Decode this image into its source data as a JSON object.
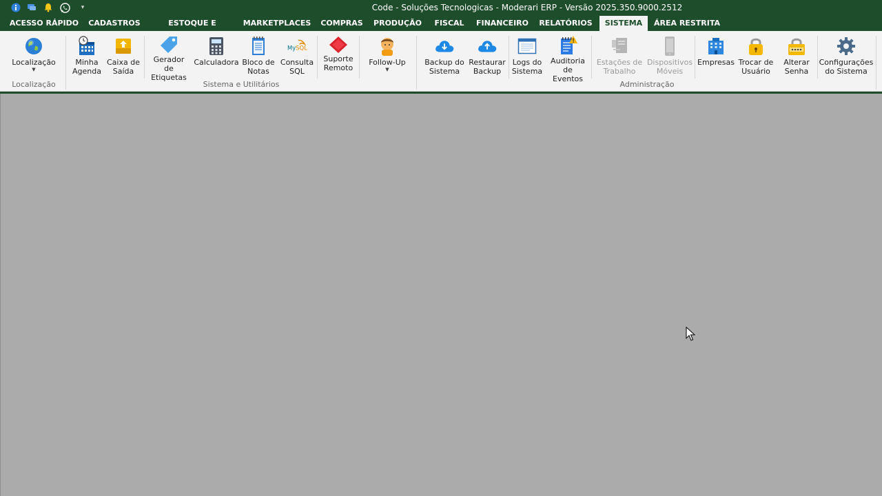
{
  "window": {
    "title": "Code - Soluções Tecnologicas - Moderari ERP - Versão 2025.350.9000.2512"
  },
  "quick_access": [
    "info-icon",
    "chat-icon",
    "bell-icon",
    "whatsapp-icon",
    "customize-dropdown-icon"
  ],
  "tabs": [
    {
      "label": "ACESSO RÁPIDO"
    },
    {
      "label": "CADASTROS"
    },
    {
      "label": "ESTOQUE E SERVIÇOS"
    },
    {
      "label": "MARKETPLACES"
    },
    {
      "label": "COMPRAS"
    },
    {
      "label": "PRODUÇÃO"
    },
    {
      "label": "FISCAL"
    },
    {
      "label": "FINANCEIRO"
    },
    {
      "label": "RELATÓRIOS"
    },
    {
      "label": "SISTEMA",
      "active": true
    },
    {
      "label": "ÁREA RESTRITA"
    }
  ],
  "ribbon": {
    "groups": [
      {
        "label": "Localização"
      },
      {
        "label": "Sistema e Utilitários"
      },
      {
        "label": "Administração"
      }
    ],
    "buttons": {
      "localizacao": {
        "label": "Localização",
        "icon": "globe-icon"
      },
      "minha_agenda": {
        "label": "Minha\nAgenda",
        "icon": "calendar-clock-icon"
      },
      "caixa_saida": {
        "label": "Caixa de\nSaída",
        "icon": "outbox-icon"
      },
      "gerador_etiquetas": {
        "label": "Gerador de\nEtiquetas",
        "icon": "tag-icon"
      },
      "calculadora": {
        "label": "Calculadora",
        "icon": "calculator-icon"
      },
      "bloco_notas": {
        "label": "Bloco de\nNotas",
        "icon": "notepad-icon"
      },
      "consulta_sql": {
        "label": "Consulta\nSQL",
        "icon": "mysql-icon"
      },
      "suporte_remoto": {
        "label": "Suporte\nRemoto",
        "icon": "remote-support-icon"
      },
      "follow_up": {
        "label": "Follow-Up",
        "icon": "person-icon"
      },
      "backup": {
        "label": "Backup do\nSistema",
        "icon": "cloud-download-icon"
      },
      "restaurar": {
        "label": "Restaurar\nBackup",
        "icon": "cloud-upload-icon"
      },
      "logs": {
        "label": "Logs do\nSistema",
        "icon": "log-window-icon"
      },
      "auditoria": {
        "label": "Auditoria\nde Eventos",
        "icon": "audit-icon"
      },
      "estacoes": {
        "label": "Estações de\nTrabalho",
        "icon": "workstation-icon",
        "disabled": true
      },
      "dispositivos": {
        "label": "Dispositivos\nMóveis",
        "icon": "mobile-icon",
        "disabled": true
      },
      "empresas": {
        "label": "Empresas",
        "icon": "building-icon"
      },
      "trocar_usuario": {
        "label": "Trocar de\nUsuário",
        "icon": "lock-icon"
      },
      "alterar_senha": {
        "label": "Alterar\nSenha",
        "icon": "password-icon"
      },
      "configuracoes": {
        "label": "Configurações\ndo Sistema",
        "icon": "gear-icon"
      }
    }
  },
  "colors": {
    "brand": "#1e4d2b",
    "ribbon_bg": "#f3f3f3",
    "workspace_bg": "#ababab"
  }
}
